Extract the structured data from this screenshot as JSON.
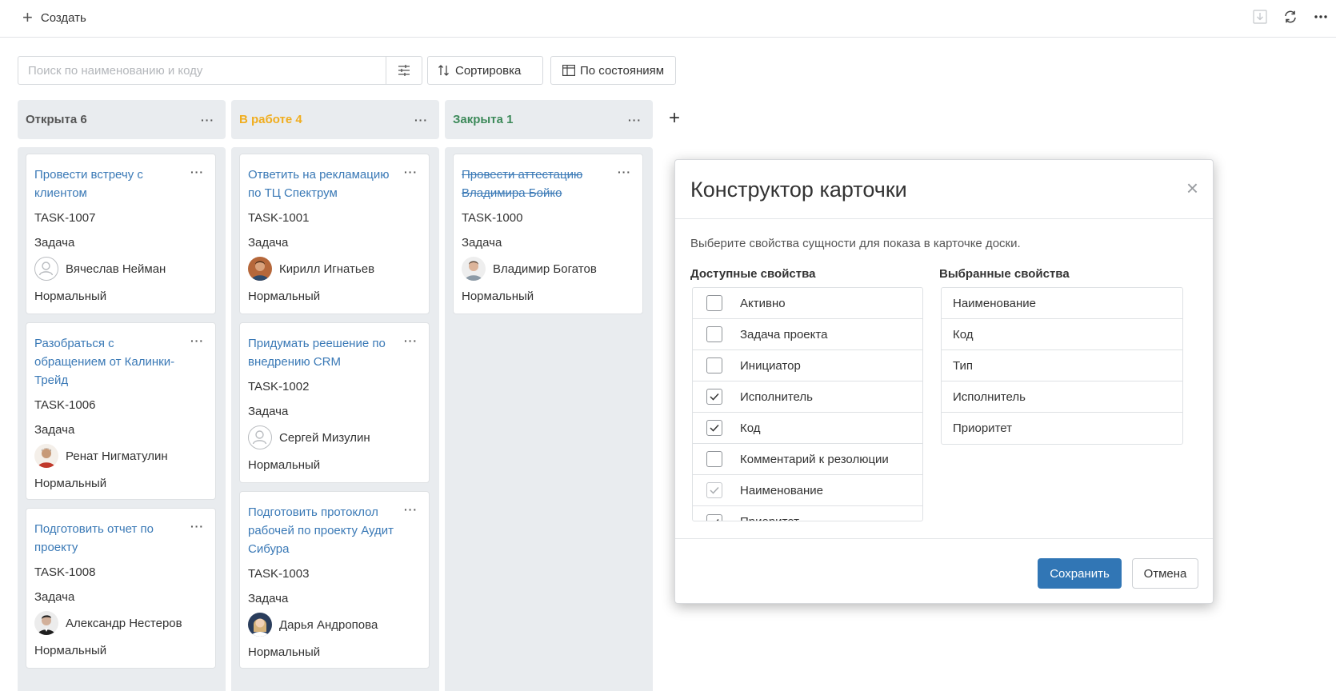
{
  "toolbar": {
    "create_label": "Создать",
    "icons": [
      "download-icon",
      "refresh-icon",
      "more-icon"
    ]
  },
  "search": {
    "placeholder": "Поиск по наименованию и коду",
    "value": ""
  },
  "buttons": {
    "sort": "Сортировка",
    "group": "По состояниям"
  },
  "columns": [
    {
      "title": "Открыта 6",
      "color": "#555555",
      "cards": [
        {
          "title": "Провести встречу с клиентом",
          "code": "TASK-1007",
          "type": "Задача",
          "assignee": "Вячеслав Нейман",
          "avatar": "empty",
          "priority": "Нормальный"
        },
        {
          "title": "Разобраться с обращением от Калинки-Трейд",
          "code": "TASK-1006",
          "type": "Задача",
          "assignee": "Ренат Нигматулин",
          "avatar": "photo",
          "priority": "Нормальный"
        },
        {
          "title": "Подготовить отчет по проекту",
          "code": "TASK-1008",
          "type": "Задача",
          "assignee": "Александр Нестеров",
          "avatar": "photo",
          "priority": "Нормальный"
        }
      ]
    },
    {
      "title": "В работе 4",
      "color": "#f0ad1e",
      "cards": [
        {
          "title": "Ответить на рекламацию по ТЦ Спектрум",
          "code": "TASK-1001",
          "type": "Задача",
          "assignee": "Кирилл Игнатьев",
          "avatar": "photo",
          "priority": "Нормальный"
        },
        {
          "title": "Придумать реешение по внедрению CRM",
          "code": "TASK-1002",
          "type": "Задача",
          "assignee": "Сергей Мизулин",
          "avatar": "empty",
          "priority": "Нормальный"
        },
        {
          "title": "Подготовить протоклол рабочей по проекту Аудит Сибура",
          "code": "TASK-1003",
          "type": "Задача",
          "assignee": "Дарья Андропова",
          "avatar": "photo",
          "priority": "Нормальный"
        }
      ]
    },
    {
      "title": "Закрыта 1",
      "color": "#3d8a5a",
      "cards": [
        {
          "title": "Провести аттестацию Владимира Бойко",
          "code": "TASK-1000",
          "type": "Задача",
          "assignee": "Владимир Богатов",
          "avatar": "photo",
          "priority": "Нормальный",
          "done": true
        }
      ]
    }
  ],
  "modal": {
    "title": "Конструктор карточки",
    "description": "Выберите свойства сущности для показа в карточке доски.",
    "available_label": "Доступные свойства",
    "selected_label": "Выбранные свойства",
    "available": [
      {
        "label": "Активно",
        "checked": false,
        "disabled": false
      },
      {
        "label": "Задача проекта",
        "checked": false,
        "disabled": false
      },
      {
        "label": "Инициатор",
        "checked": false,
        "disabled": false
      },
      {
        "label": "Исполнитель",
        "checked": true,
        "disabled": false
      },
      {
        "label": "Код",
        "checked": true,
        "disabled": false
      },
      {
        "label": "Комментарий к резолюции",
        "checked": false,
        "disabled": false
      },
      {
        "label": "Наименование",
        "checked": true,
        "disabled": true
      },
      {
        "label": "Приоритет",
        "checked": true,
        "disabled": false
      }
    ],
    "selected": [
      "Наименование",
      "Код",
      "Тип",
      "Исполнитель",
      "Приоритет"
    ],
    "save_label": "Сохранить",
    "cancel_label": "Отмена"
  }
}
